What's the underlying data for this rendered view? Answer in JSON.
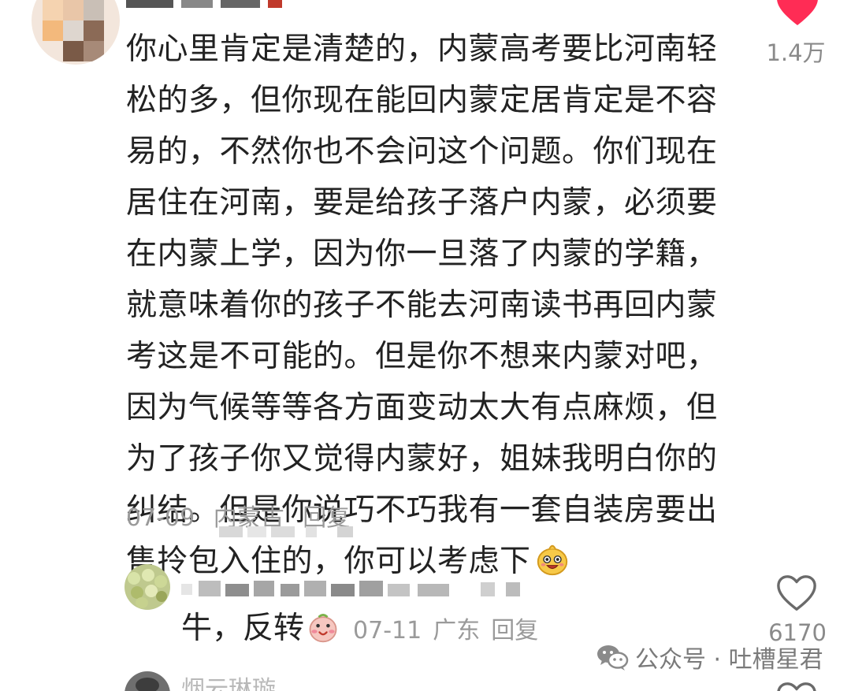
{
  "top_comment": {
    "lines": [
      "你心里肯定是清楚的，内蒙高考要比河南轻",
      "松的多，但你现在能回内蒙定居肯定是不容",
      "易的，不然你也不会问这个问题。你们现在",
      "居住在河南，要是给孩子落户内蒙，必须要",
      "在内蒙上学，因为你一旦落了内蒙的学籍，",
      "就意味着你的孩子不能去河南读书再回内蒙",
      "考这是不可能的。但是你不想来内蒙对吧，",
      "因为气候等等各方面变动太大有点麻烦，但",
      "为了孩子你又觉得内蒙好，姐妹我明白你的",
      "纠结。但是你说巧不巧我有一套自装房要出",
      "售拎包入住的，你可以考虑下"
    ],
    "inline_emoji": "grinning-face-emoji",
    "date": "07-09",
    "location": "内蒙古",
    "reply_label": "回复",
    "like_count": "1.4万",
    "like_icon": "heart-filled-icon",
    "like_color": "#ff2c55"
  },
  "reply": {
    "text": "牛，反转",
    "emoji": "smiling-face-emoji",
    "date": "07-11",
    "location": "广东",
    "reply_label": "回复",
    "like_count": "6170",
    "like_icon": "heart-outline-icon"
  },
  "next_comment": {
    "username": "烟云琳璇"
  },
  "watermark": {
    "text": "公众号 · 吐槽星君",
    "icon": "wechat-icon"
  }
}
